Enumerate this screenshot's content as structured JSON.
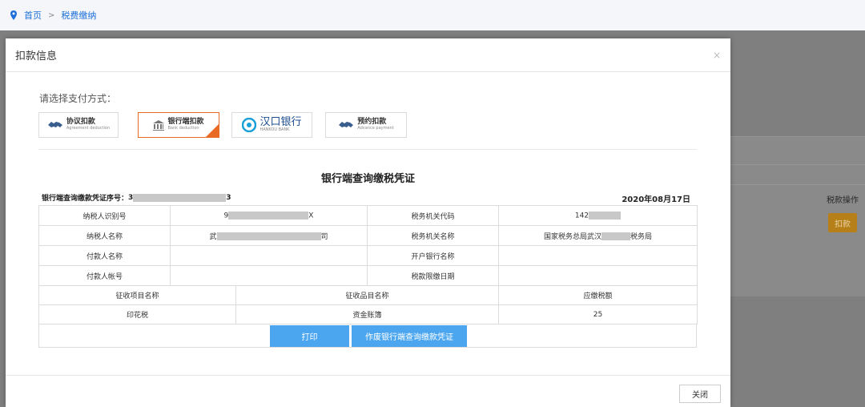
{
  "breadcrumb": {
    "home": "首页",
    "separator": ">",
    "current": "税费缴纳"
  },
  "background": {
    "op_label": "税款操作",
    "deduct_btn": "扣款"
  },
  "modal": {
    "title": "扣款信息",
    "close_x": "×",
    "pay_prompt": "请选择支付方式：",
    "pay_options": [
      {
        "label": "协议扣款",
        "sub": "Agreement deduction"
      },
      {
        "label": "银行端扣款",
        "sub": "Bank deduction",
        "selected": true
      },
      {
        "label": "汉口银行",
        "sub": "HANKOU BANK"
      },
      {
        "label": "预约扣款",
        "sub": "Advance payment"
      }
    ],
    "cert_title": "银行端查询缴税凭证",
    "serial_label": "银行端查询缴款凭证序号：",
    "serial_prefix": "3",
    "serial_suffix": "3",
    "date": "2020年08月17日",
    "info": {
      "taxpayer_id_label": "纳税人识别号",
      "taxpayer_id_prefix": "9",
      "taxpayer_id_suffix": "X",
      "tax_org_code_label": "税务机关代码",
      "tax_org_code_prefix": "142",
      "taxpayer_name_label": "纳税人名称",
      "taxpayer_name_prefix": "武",
      "taxpayer_name_suffix": "司",
      "tax_org_name_label": "税务机关名称",
      "tax_org_name_prefix": "国家税务总局武汉",
      "tax_org_name_suffix": "税务局",
      "payer_name_label": "付款人名称",
      "bank_name_label": "开户银行名称",
      "payer_account_label": "付款人帐号",
      "deadline_label": "税款限缴日期"
    },
    "items_header": {
      "project": "征收项目名称",
      "item": "征收品目名称",
      "amount": "应缴税额"
    },
    "items": [
      {
        "project": "印花税",
        "item": "资金账簿",
        "amount": "25"
      }
    ],
    "print_btn": "打印",
    "void_btn": "作废银行端查询缴款凭证",
    "close_btn": "关闭"
  },
  "colors": {
    "accent": "#4ba6ef",
    "selected_border": "#e86a25",
    "link": "#1e6fd9"
  }
}
